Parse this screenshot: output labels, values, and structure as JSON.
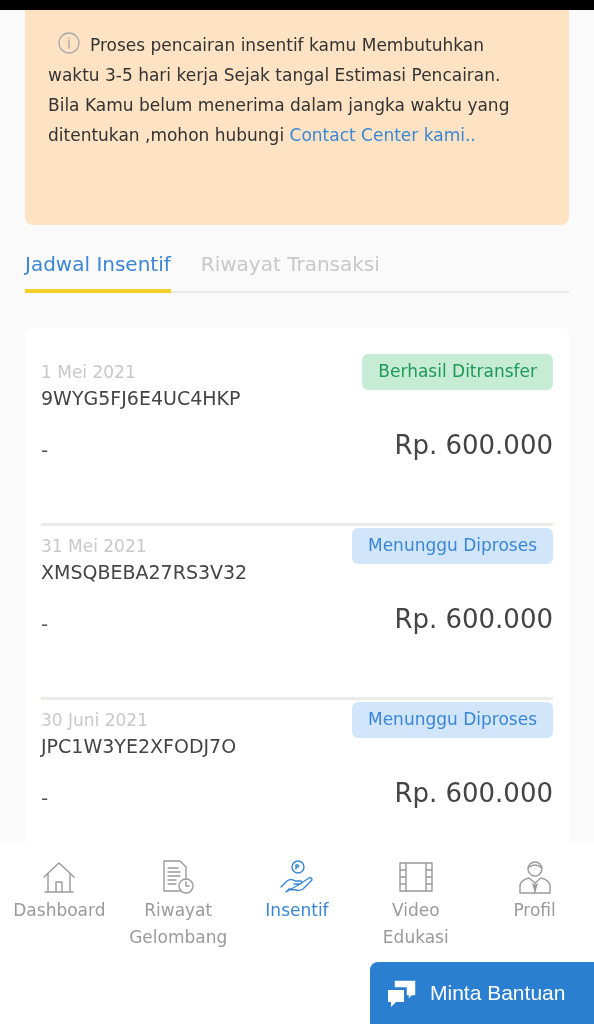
{
  "notice": {
    "text": "Proses pencairan insentif kamu Membutuhkan waktu 3-5 hari kerja Sejak tangal Estimasi Pencairan. Bila Kamu belum menerima dalam jangka waktu yang ditentukan ,mohon hubungi ",
    "link": "Contact Center kami.."
  },
  "tabs": [
    {
      "label": "Jadwal Insentif",
      "selected": true
    },
    {
      "label": "Riwayat Transaksi",
      "selected": false
    }
  ],
  "payments": [
    {
      "date": "1 Mei 2021",
      "code": "9WYG5FJ6E4UC4HKP",
      "status": "Berhasil Ditransfer",
      "kind": "success",
      "note": "-",
      "amount": "Rp. 600.000"
    },
    {
      "date": "31 Mei 2021",
      "code": "XMSQBEBA27RS3V32",
      "status": "Menunggu Diproses",
      "kind": "pending",
      "note": "-",
      "amount": "Rp. 600.000"
    },
    {
      "date": "30 Juni 2021",
      "code": "JPC1W3YE2XFODJ7O",
      "status": "Menunggu Diproses",
      "kind": "pending",
      "note": "-",
      "amount": "Rp. 600.000"
    }
  ],
  "nav": [
    {
      "label": "Dashboard",
      "kind": "home",
      "selected": false
    },
    {
      "label": "Riwayat Gelombang",
      "kind": "doc",
      "selected": false
    },
    {
      "label": "Insentif",
      "kind": "hand",
      "selected": true
    },
    {
      "label": "Video Edukasi",
      "kind": "film",
      "selected": false
    },
    {
      "label": "Profil",
      "kind": "person",
      "selected": false
    }
  ],
  "help_button": "Minta Bantuan"
}
